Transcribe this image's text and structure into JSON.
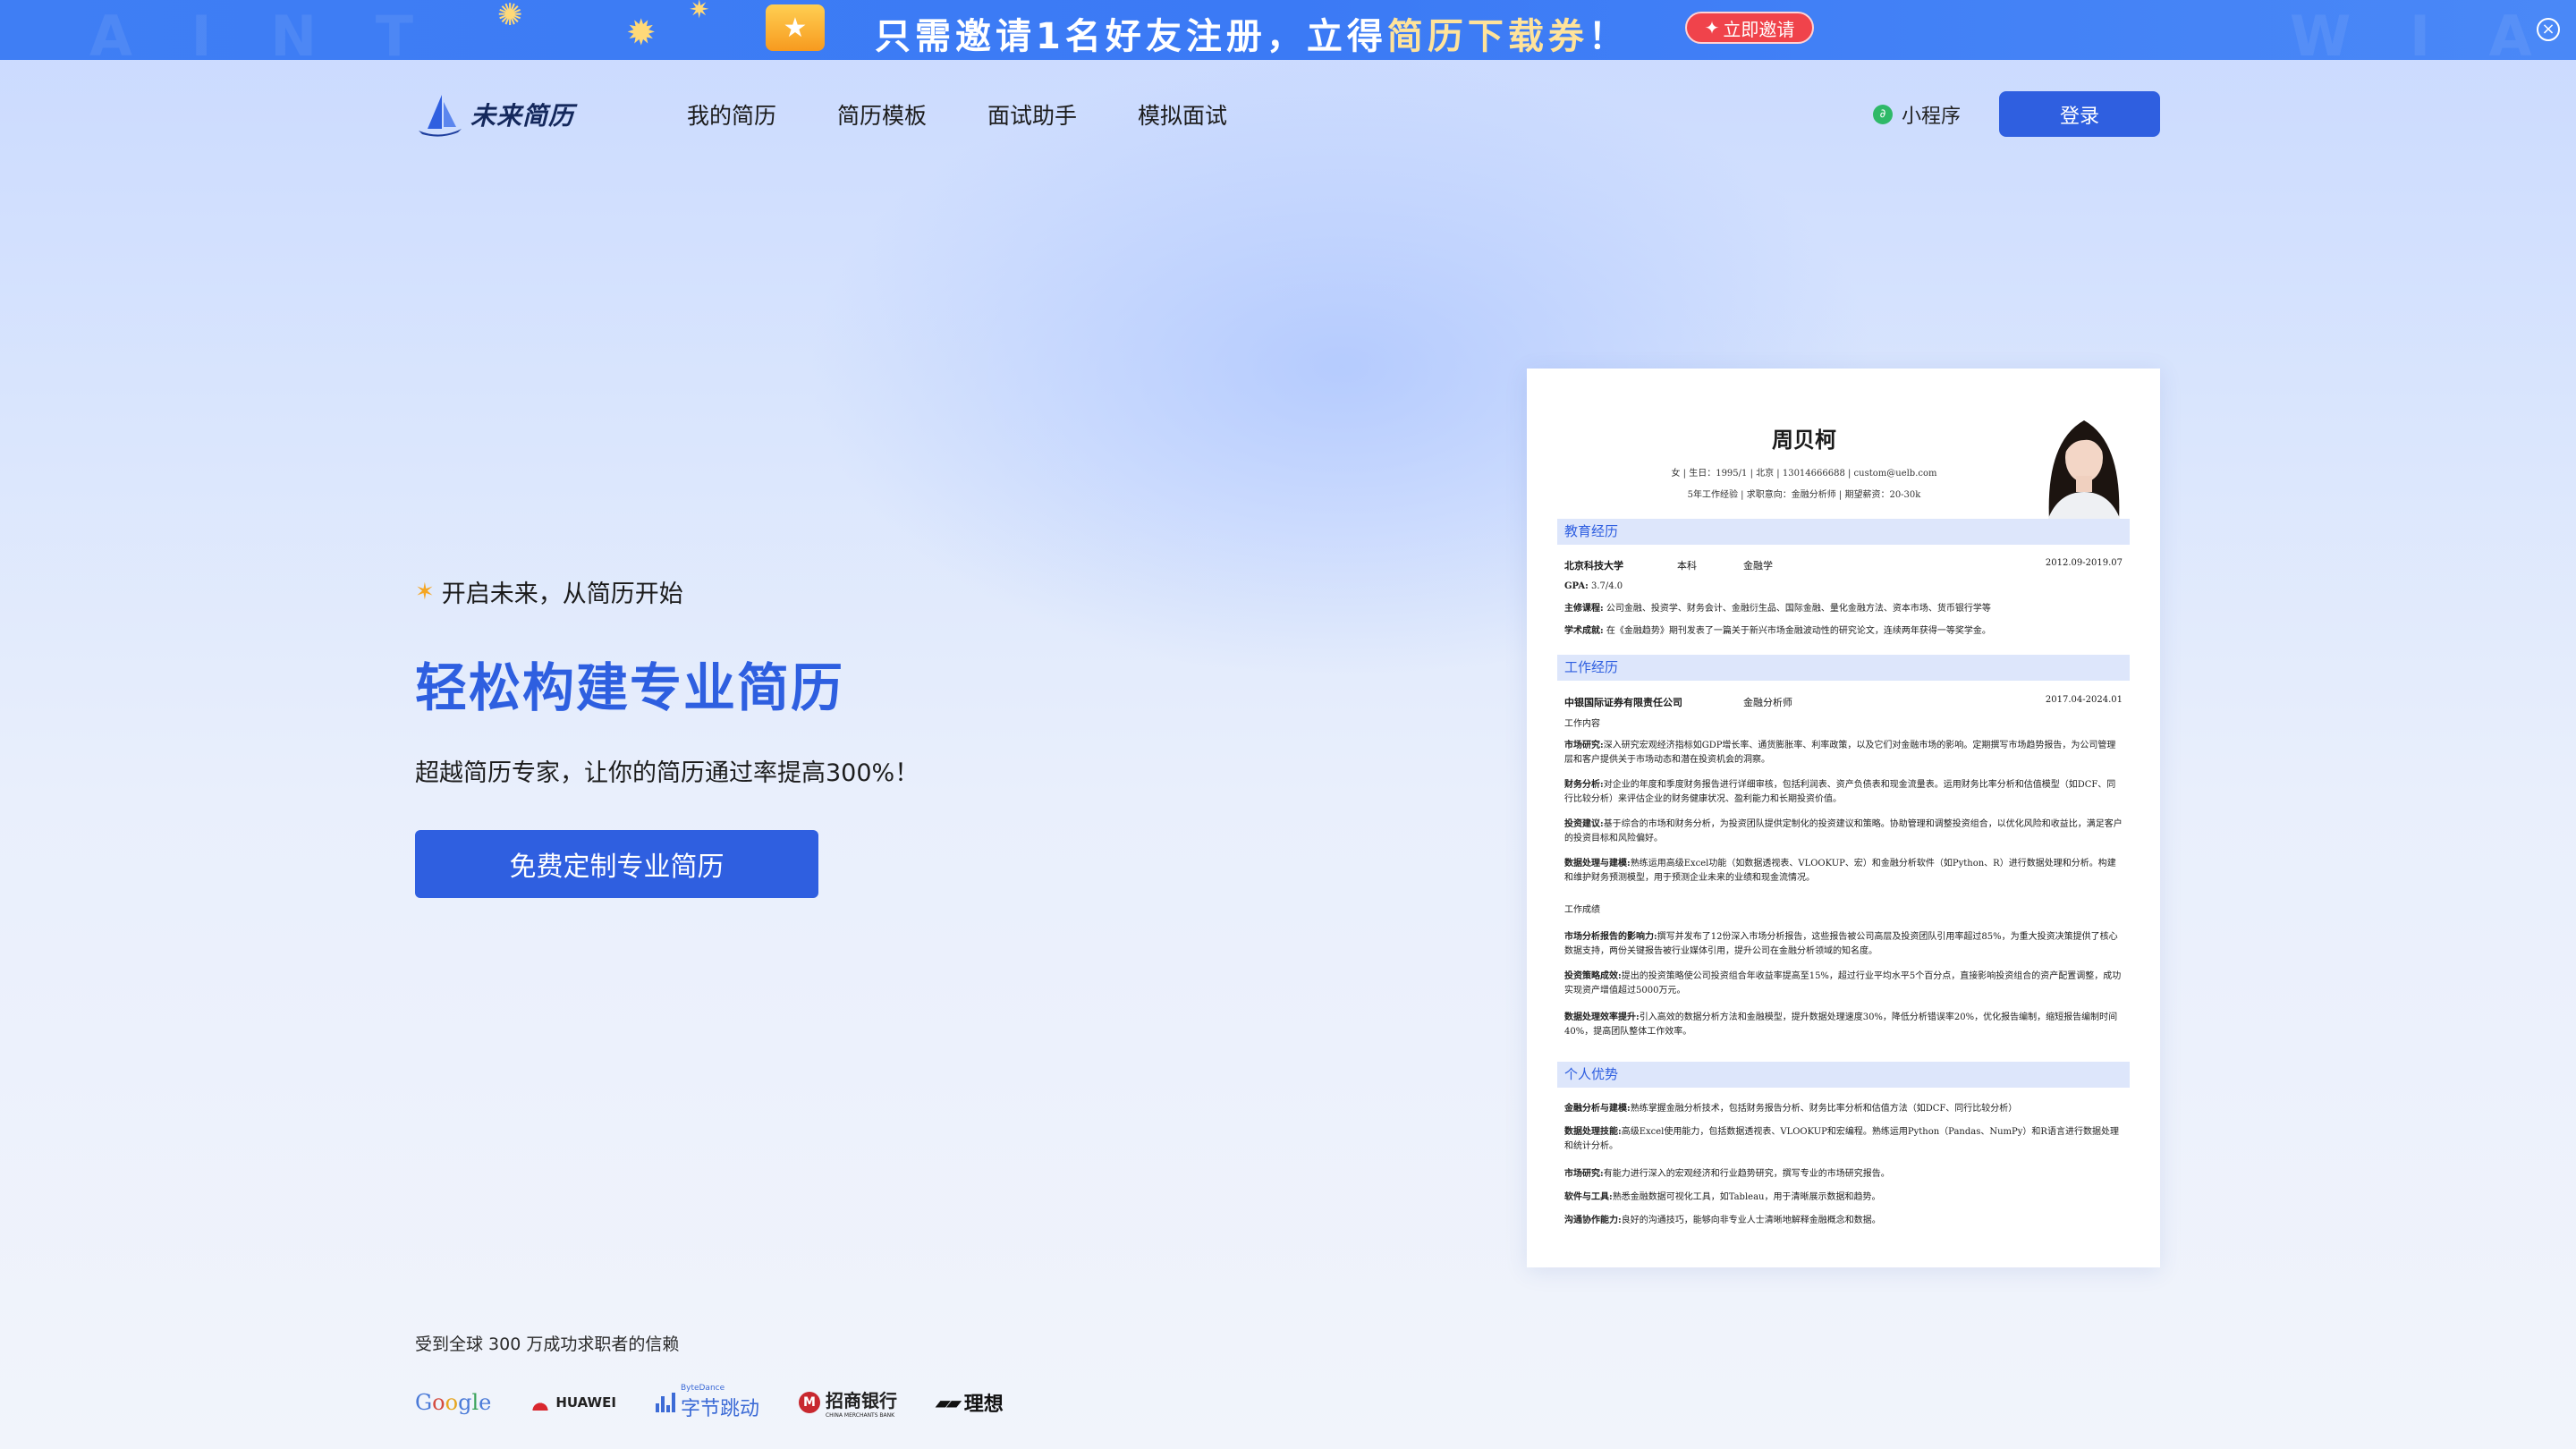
{
  "promo": {
    "text_main": "只需邀请1名好友注册，立得",
    "text_highlight": "简历下载券",
    "text_tail": "！",
    "button_label": "立即邀请"
  },
  "nav": {
    "logo_text": "未来简历",
    "menu": [
      "我的简历",
      "简历模板",
      "面试助手",
      "模拟面试"
    ],
    "mini_program": "小程序",
    "login": "登录"
  },
  "hero": {
    "eyebrow": "开启未来，从简历开始",
    "title": "轻松构建专业简历",
    "subtitle": "超越简历专家，让你的简历通过率提高300%！",
    "cta": "免费定制专业简历"
  },
  "trust": {
    "text": "受到全球 300 万成功求职者的信赖",
    "logos": {
      "google": "Google",
      "huawei": "HUAWEI",
      "bytedance_small": "ByteDance",
      "bytedance": "字节跳动",
      "cmb": "招商银行",
      "cmb_small": "CHINA MERCHANTS BANK",
      "lixiang": "理想"
    }
  },
  "resume": {
    "name": "周贝柯",
    "info1": "女  |  生日：1995/1    |  北京  |  13014666688    |  custom@uelb.com",
    "info2": "5年工作经验  |  求职意向：金融分析师  |  期望薪资：20-30k",
    "sections": [
      "教育经历",
      "工作经历",
      "个人优势"
    ],
    "education": {
      "school": "北京科技大学",
      "degree": "本科",
      "major": "金融学",
      "date": "2012.09-2019.07",
      "gpa_label": "GPA:",
      "gpa": "3.7/4.0",
      "courses_label": "主修课程:",
      "courses": "公司金融、投资学、财务会计、金融衍生品、国际金融、量化金融方法、资本市场、货币银行学等",
      "achievement_label": "学术成就:",
      "achievement": "在《金融趋势》期刊发表了一篇关于新兴市场金融波动性的研究论文，连续两年获得一等奖学金。"
    },
    "work": {
      "company": "中银国际证券有限责任公司",
      "role": "金融分析师",
      "date": "2017.04-2024.01",
      "content_heading": "工作内容",
      "items": [
        {
          "label": "市场研究:",
          "text": "深入研究宏观经济指标如GDP增长率、通货膨胀率、利率政策，以及它们对金融市场的影响。定期撰写市场趋势报告，为公司管理层和客户提供关于市场动态和潜在投资机会的洞察。"
        },
        {
          "label": "财务分析:",
          "text": "对企业的年度和季度财务报告进行详细审核，包括利润表、资产负债表和现金流量表。运用财务比率分析和估值模型（如DCF、同行比较分析）来评估企业的财务健康状况、盈利能力和长期投资价值。"
        },
        {
          "label": "投资建议:",
          "text": "基于综合的市场和财务分析，为投资团队提供定制化的投资建议和策略。协助管理和调整投资组合，以优化风险和收益比，满足客户的投资目标和风险偏好。"
        },
        {
          "label": "数据处理与建模:",
          "text": "熟练运用高级Excel功能（如数据透视表、VLOOKUP、宏）和金融分析软件（如Python、R）进行数据处理和分析。构建和维护财务预测模型，用于预测企业未来的业绩和现金流情况。"
        }
      ],
      "results_heading": "工作成绩",
      "results": [
        {
          "label": "市场分析报告的影响力:",
          "text": "撰写并发布了12份深入市场分析报告，这些报告被公司高层及投资团队引用率超过85%，为重大投资决策提供了核心数据支持，两份关键报告被行业媒体引用，提升公司在金融分析领域的知名度。"
        },
        {
          "label": "投资策略成效:",
          "text": "提出的投资策略使公司投资组合年收益率提高至15%，超过行业平均水平5个百分点，直接影响投资组合的资产配置调整，成功实现资产增值超过5000万元。"
        },
        {
          "label": "数据处理效率提升:",
          "text": "引入高效的数据分析方法和金融模型，提升数据处理速度30%，降低分析错误率20%，优化报告编制，缩短报告编制时间40%，提高团队整体工作效率。"
        }
      ]
    },
    "strengths": [
      {
        "label": "金融分析与建模:",
        "text": "熟练掌握金融分析技术，包括财务报告分析、财务比率分析和估值方法（如DCF、同行比较分析）"
      },
      {
        "label": "数据处理技能:",
        "text": "高级Excel使用能力，包括数据透视表、VLOOKUP和宏编程。熟练运用Python（Pandas、NumPy）和R语言进行数据处理和统计分析。"
      },
      {
        "label": "市场研究:",
        "text": "有能力进行深入的宏观经济和行业趋势研究，撰写专业的市场研究报告。"
      },
      {
        "label": "软件与工具:",
        "text": "熟悉金融数据可视化工具，如Tableau，用于清晰展示数据和趋势。"
      },
      {
        "label": "沟通协作能力:",
        "text": "良好的沟通技巧，能够向非专业人士清晰地解释金融概念和数据。"
      }
    ]
  },
  "colors": {
    "accent": "#2f5fe0",
    "promo_bg": "#3f7ef4",
    "promo_button": "#f0434b"
  }
}
